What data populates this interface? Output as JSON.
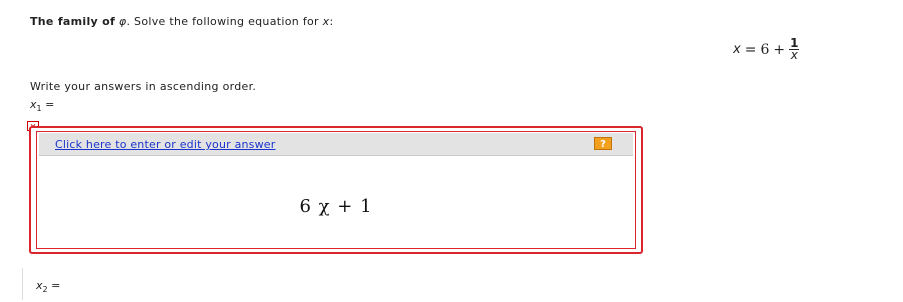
{
  "problem": {
    "family_label": "The family of",
    "phi_symbol": "φ",
    "rest_text": ". Solve the following equation for",
    "var": "x",
    "colon": ":"
  },
  "equation": {
    "lhs": "x",
    "op": "=",
    "rhs_const": "6",
    "plus": "+",
    "frac_num": "1",
    "frac_den": "x"
  },
  "instructions": "Write your answers in ascending order.",
  "x1": {
    "var": "x",
    "sub": "1",
    "eq": "="
  },
  "close_x": "×",
  "answer": {
    "link_text": "Click here to enter or edit your answer",
    "help_glyph": "?",
    "value": "6 χ + 1"
  },
  "x2": {
    "var": "x",
    "sub": "2",
    "eq": "="
  },
  "colors": {
    "accent_red": "#d9252b",
    "link_blue": "#1a33cc",
    "help_orange": "#f2a01e"
  }
}
